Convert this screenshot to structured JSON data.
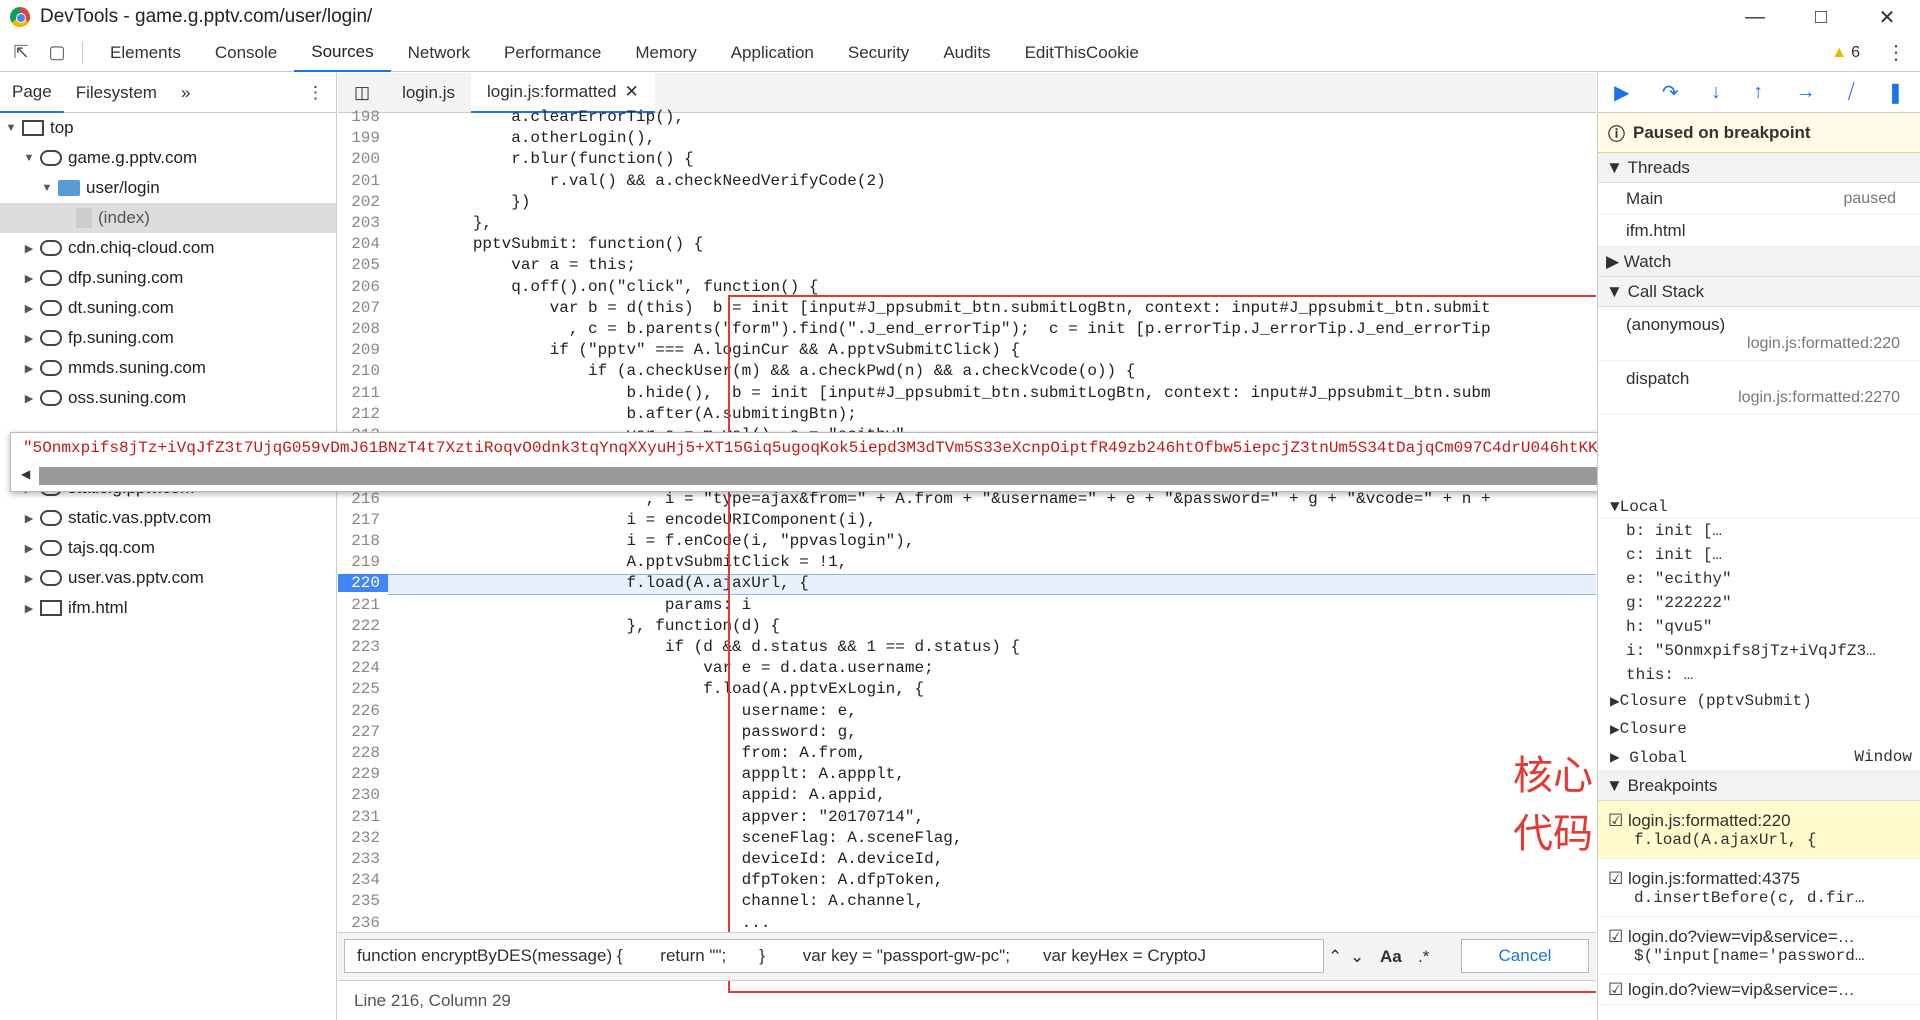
{
  "window": {
    "title": "DevTools - game.g.pptv.com/user/login/"
  },
  "toolbar": {
    "tabs": [
      "Elements",
      "Console",
      "Sources",
      "Network",
      "Performance",
      "Memory",
      "Application",
      "Security",
      "Audits",
      "EditThisCookie"
    ],
    "warning_count": "6"
  },
  "navigator": {
    "tabs": [
      "Page",
      "Filesystem"
    ],
    "tree": [
      "top",
      "game.g.pptv.com",
      "user/login",
      "(index)",
      "cdn.chiq-cloud.com",
      "dfp.suning.com",
      "dt.suning.com",
      "fp.suning.com",
      "mmds.suning.com",
      "oss.suning.com",
      "static.g.pptv.com",
      "static.vas.pptv.com",
      "tajs.qq.com",
      "user.vas.pptv.com",
      "ifm.html"
    ]
  },
  "editor": {
    "tabs": [
      "login.js",
      "login.js:formatted"
    ],
    "line_numbers": [
      "198",
      "199",
      "200",
      "201",
      "202",
      "203",
      "204",
      "205",
      "206",
      "207",
      "208",
      "209",
      "210",
      "211",
      "212",
      "213",
      "216",
      "217",
      "218",
      "219",
      "220",
      "221",
      "222",
      "223",
      "224",
      "225",
      "226",
      "227",
      "228",
      "229",
      "230",
      "231",
      "232",
      "233",
      "234",
      "235",
      "236"
    ],
    "lines": [
      "            a.clearErrorTip(),",
      "            a.otherLogin(),",
      "            r.blur(function() {",
      "                r.val() && a.checkNeedVerifyCode(2)",
      "            })",
      "        },",
      "        pptvSubmit: function() {",
      "            var a = this;",
      "            q.off().on(\"click\", function() {",
      "                var b = d(this)  b = init [input#J_ppsubmit_btn.submitLogBtn, context: input#J_ppsubmit_btn.submit",
      "                  , c = b.parents(\"form\").find(\".J_end_errorTip\");  c = init [p.errorTip.J_errorTip.J_end_errorTip",
      "                if (\"pptv\" === A.loginCur && A.pptvSubmitClick) {",
      "                    if (a.checkUser(m) && a.checkPwd(n) && a.checkVcode(o)) {",
      "                        b.hide(),  b = init [input#J_ppsubmit_btn.submitLogBtn, context: input#J_ppsubmit_btn.subm",
      "                        b.after(A.submitingBtn);",
      "                        var e = m.val()  e = \"ecithy\"",
      "                          , i = \"type=ajax&from=\" + A.from + \"&username=\" + e + \"&password=\" + g + \"&vcode=\" + n +",
      "                        i = encodeURIComponent(i),",
      "                        i = f.enCode(i, \"ppvaslogin\"),",
      "                        A.pptvSubmitClick = !1,",
      "                        f.load(A.ajaxUrl, {",
      "                            params: i",
      "                        }, function(d) {",
      "                            if (d && d.status && 1 == d.status) {",
      "                                var e = d.data.username;",
      "                                f.load(A.pptvExLogin, {",
      "                                    username: e,",
      "                                    password: g,",
      "                                    from: A.from,",
      "                                    appplt: A.appplt,",
      "                                    appid: A.appid,",
      "                                    appver: \"20170714\",",
      "                                    sceneFlag: A.sceneFlag,",
      "                                    deviceId: A.deviceId,",
      "                                    dfpToken: A.dfpToken,",
      "                                    channel: A.channel,",
      "                                    ..."
    ],
    "annotation": "核心代码",
    "tooltip_value": "\"5Onmxpifs8jTz+iVqJfZ3t7UjqG059vDmJ61BNzT4t7XztiRoqvO0dnk3tqYnqXXyuHj5+XT15Giq5ugoqKok5iepd3M3dTVm5S33eXcnpOiptfR49zb246htOfbw5iepcjZ3tnUm5S34tDajqCm097C4drU046htKKmmaOcn5iZoaCgrYalouLKztzVtu",
    "search_text": "function encryptByDES(message) {        return \"\";       }        var key = \"passport-gw-pc\";       var keyHex = CryptoJ",
    "search_case": "Aa",
    "search_regex": ".*",
    "cancel_label": "Cancel",
    "status": "Line 216, Column 29"
  },
  "debugger": {
    "paused_label": "Paused on breakpoint",
    "threads_label": "Threads",
    "threads": [
      {
        "name": "Main",
        "state": "paused"
      },
      {
        "name": "ifm.html",
        "state": ""
      }
    ],
    "watch_label": "Watch",
    "callstack_label": "Call Stack",
    "callstack": [
      {
        "fn": "(anonymous)",
        "loc": "login.js:formatted:220"
      },
      {
        "fn": "dispatch",
        "loc": "login.js:formatted:2270"
      }
    ],
    "scope_local": "Local",
    "locals": [
      "b: init […",
      "c: init […",
      "e: \"ecithy\"",
      "g: \"222222\"",
      "h: \"qvu5\"",
      "i: \"5Onmxpifs8jTz+iVqJfZ3…",
      "this: …"
    ],
    "closure1": "Closure (pptvSubmit)",
    "closure2": "Closure",
    "global": "Global",
    "global_val": "Window",
    "breakpoints_label": "Breakpoints",
    "breakpoints": [
      {
        "loc": "login.js:formatted:220",
        "code": "f.load(A.ajaxUrl, {"
      },
      {
        "loc": "login.js:formatted:4375",
        "code": "d.insertBefore(c, d.fir…"
      },
      {
        "loc": "login.do?view=vip&service=…",
        "code": "$(\"input[name='password…"
      },
      {
        "loc": "login.do?view=vip&service=…",
        "code": ""
      }
    ]
  }
}
